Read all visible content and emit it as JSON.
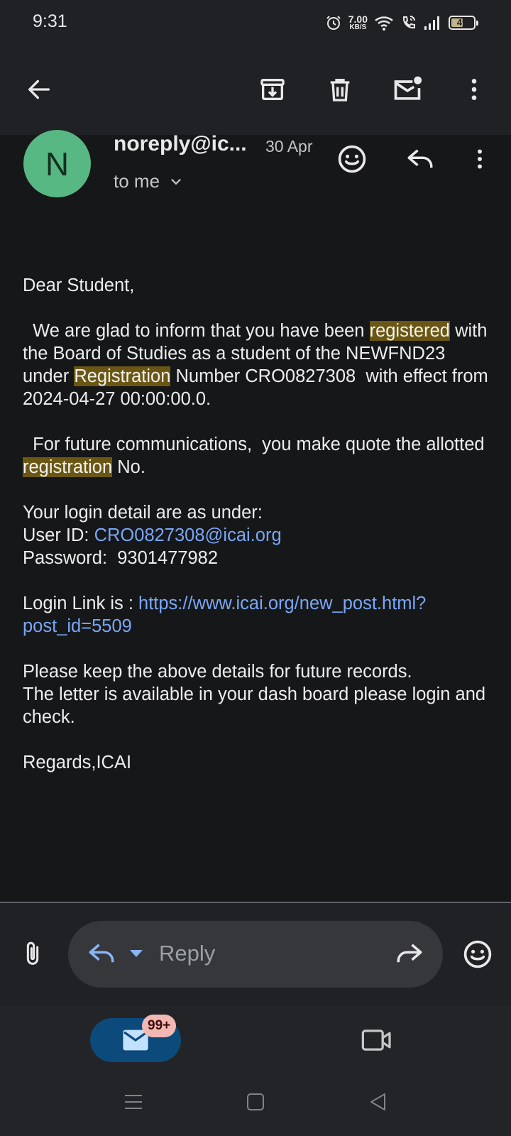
{
  "status_bar": {
    "time": "9:31",
    "net_speed_value": "7.00",
    "net_speed_unit": "KB/S",
    "battery": "49",
    "icons": [
      "alarm-icon",
      "wifi-icon",
      "wifi-calling-icon",
      "signal-icon",
      "battery-icon"
    ]
  },
  "toolbar": {
    "icons": [
      "back-arrow-icon",
      "archive-icon",
      "delete-icon",
      "mark-unread-icon",
      "more-vert-icon"
    ]
  },
  "email": {
    "avatar_letter": "N",
    "sender": "noreply@ic...",
    "date": "30 Apr",
    "recipient": "to me",
    "greeting": "Dear Student,",
    "p1_a": "  We are glad to inform that you have been ",
    "p1_hl1": "registered",
    "p1_b": " with the Board of Studies as a student of the NEWFND23 under ",
    "p1_hl2": "Registration",
    "p1_c": " Number CRO0827308  with effect from   2024-04-27 00:00:00.0.",
    "p2_a": "  For future communications,  you make quote the allotted ",
    "p2_hl": "registration",
    "p2_b": " No.",
    "login_intro": "Your login detail are as under:",
    "user_id_label": "User ID: ",
    "user_id": "CRO0827308@icai.org",
    "password_label": "Password:  ",
    "password": "9301477982",
    "login_link_label": "Login Link is : ",
    "login_link": "https://www.icai.org/new_post.html?post_id=5509",
    "keep_line": "Please keep the above details for future records.",
    "letter_line": "The letter is available in your dash board please login and check.",
    "regards": "Regards,ICAI"
  },
  "reply_bar": {
    "placeholder": "Reply"
  },
  "bottom_nav": {
    "badge": "99+"
  },
  "colors": {
    "background": "#161719",
    "bar": "#202124",
    "highlight": "#6b5713",
    "link": "#7aa7f5",
    "avatar": "#57b883",
    "mail_pill": "#0b4a7a",
    "badge": "#f4b8b2"
  }
}
